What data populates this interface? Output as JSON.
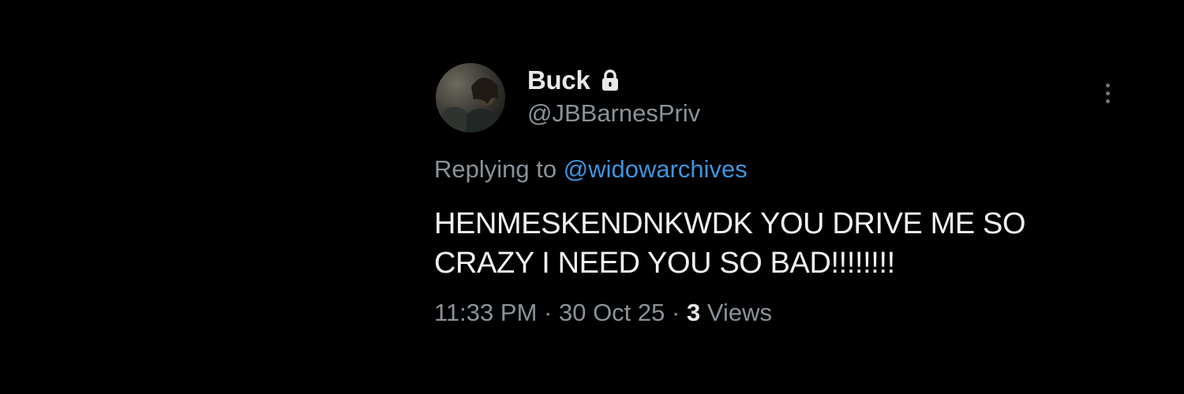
{
  "tweet": {
    "author": {
      "display_name": "Buck",
      "handle": "@JBBarnesPriv",
      "protected_icon": "lock-icon"
    },
    "replying_prefix": "Replying to",
    "replying_to": "@widowarchives",
    "text_line1": "HENMESKENDNKWDK YOU DRIVE ME SO",
    "text_line2": "CRAZY I NEED YOU SO BAD!!!!!!!!",
    "time": "11:33 PM",
    "date": "30 Oct 25",
    "separator": "·",
    "views_count": "3",
    "views_label": "Views",
    "more_icon": "more-vertical-icon"
  },
  "colors": {
    "background": "#000000",
    "primary_text": "#e7e9ea",
    "secondary_text": "#8b9299",
    "link": "#3d95e0"
  }
}
